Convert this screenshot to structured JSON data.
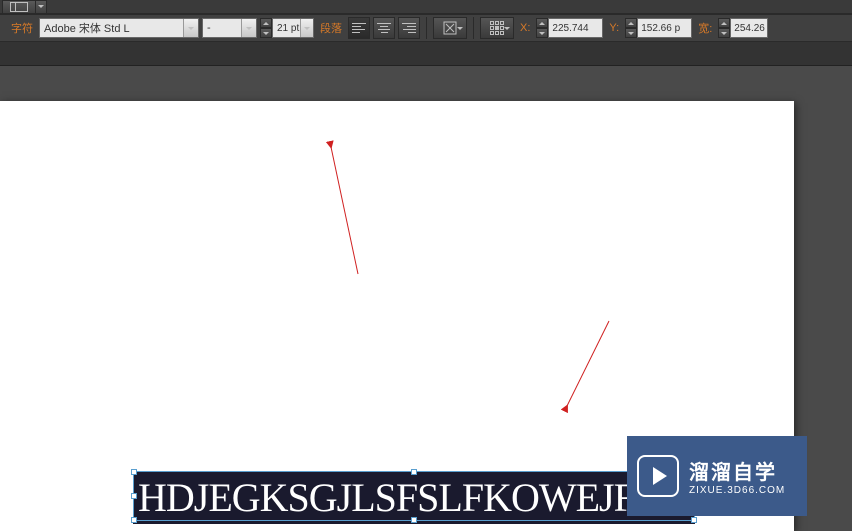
{
  "toolbar": {
    "font_label": "字符",
    "font_family": "Adobe 宋体 Std L",
    "font_style": "-",
    "font_size": "21 pt",
    "paragraph_label": "段落",
    "x_label": "X:",
    "x_value": "225.744",
    "y_label": "Y:",
    "y_value": "152.66 p",
    "w_label": "宽:",
    "w_value": "254.26"
  },
  "canvas": {
    "text_content": "HDJEGKSGJLSFSLFKOWEJF"
  },
  "watermark": {
    "title": "溜溜自学",
    "url": "ZIXUE.3D66.COM"
  }
}
